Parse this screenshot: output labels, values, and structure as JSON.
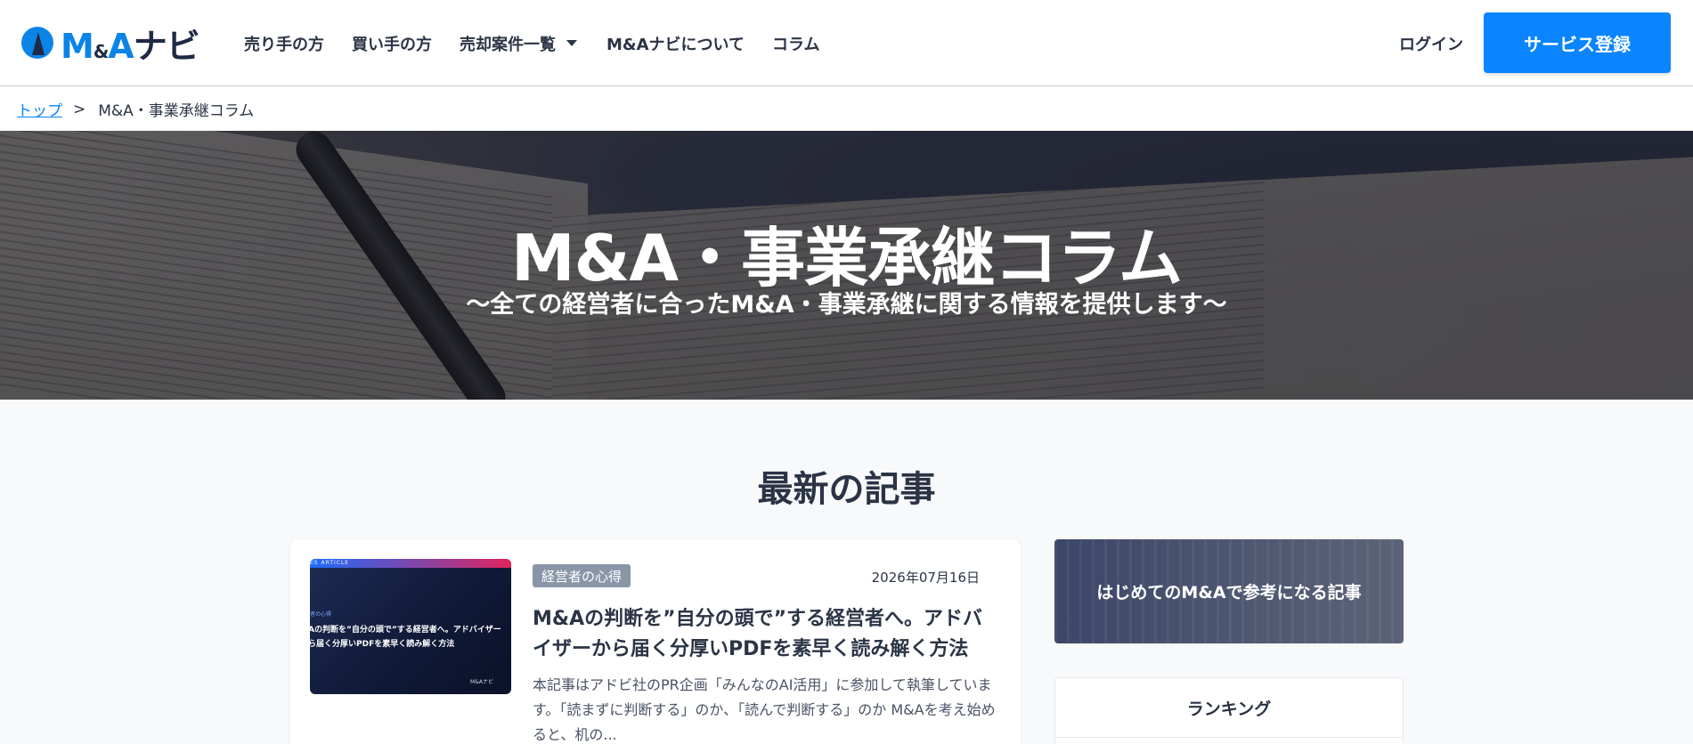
{
  "header": {
    "logo_text_m": "M",
    "logo_text_amp": "&",
    "logo_text_a": "A",
    "logo_text_navi": "ナビ",
    "nav": [
      "売り手の方",
      "買い手の方",
      "売却案件一覧",
      "M&Aナビについて",
      "コラム"
    ],
    "login_label": "ログイン",
    "signup_label": "サービス登録"
  },
  "breadcrumb": {
    "home": "トップ",
    "separator": ">",
    "current": "M&A・事業承継コラム"
  },
  "hero": {
    "title": "M&A・事業承継コラム",
    "subtitle": "〜全ての経営者に合ったM&A・事業承継に関する情報を提供します〜"
  },
  "latest": {
    "section_title": "最新の記事",
    "articles": [
      {
        "category": "経営者の心得",
        "date": "2026年07月16日",
        "title": "M&Aの判断を”自分の頭で”する経営者へ。アドバイザーから届く分厚いPDFを素早く読み解く方法",
        "excerpt": "本記事はアドビ社のPR企画「みんなのAI活用」に参加して執筆しています。「読まずに判断する」のか、「読んで判断する」のか M&Aを考え始めると、机の...",
        "thumb_tag": "ES ARTICLE",
        "thumb_cat": "者の心得",
        "thumb_line1": "Aの判断を”自分の頭で”する経営者へ。アドバイザー",
        "thumb_line2": "ら届く分厚いPDFを素早く読み解く方法",
        "thumb_mark": "M&Aナビ"
      }
    ]
  },
  "sidebar": {
    "banner_text": "はじめてのM&Aで参考になる記事",
    "ranking_title": "ランキング"
  },
  "colors": {
    "accent": "#0a84ff",
    "text": "#2b3445",
    "badge": "#8a96a8"
  }
}
